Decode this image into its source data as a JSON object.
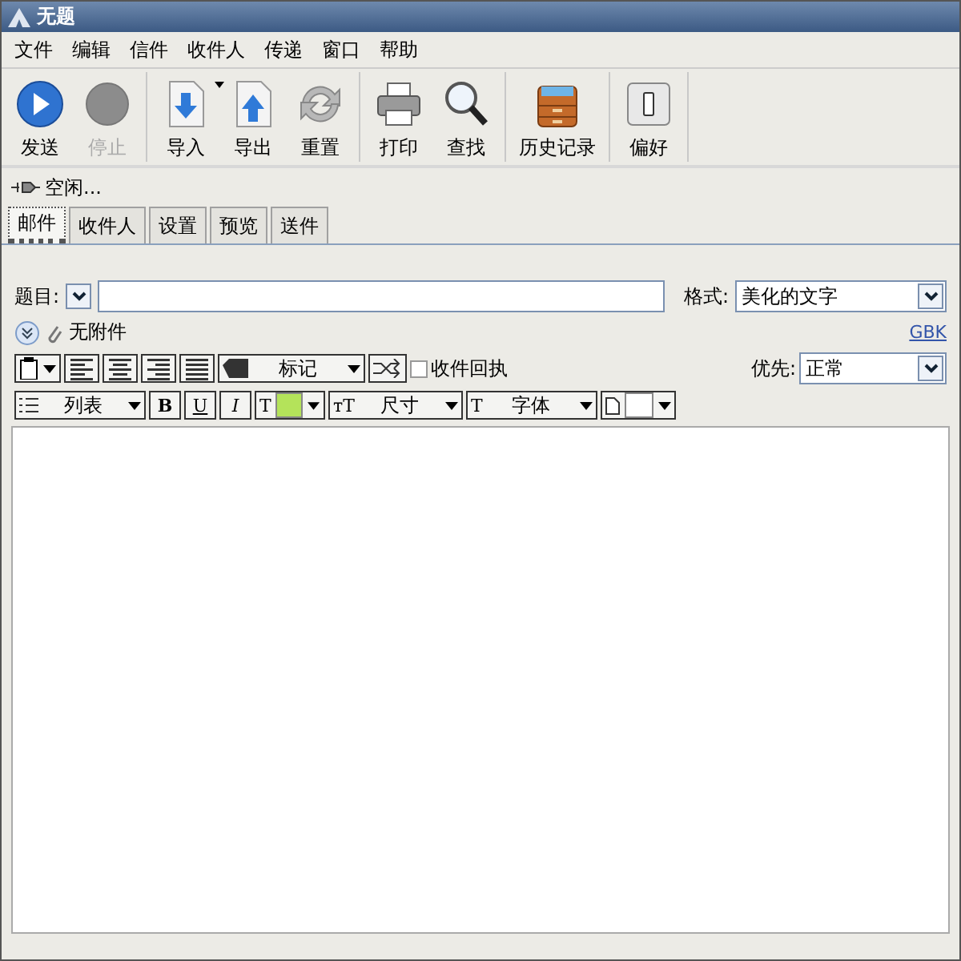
{
  "window": {
    "title": "无题"
  },
  "menu": [
    "文件",
    "编辑",
    "信件",
    "收件人",
    "传递",
    "窗口",
    "帮助"
  ],
  "toolbar": [
    {
      "buttons": [
        {
          "label": "发送",
          "kind": "send",
          "disabled": false
        },
        {
          "label": "停止",
          "kind": "stop",
          "disabled": true
        }
      ]
    },
    {
      "buttons": [
        {
          "label": "导入",
          "kind": "import",
          "disabled": false,
          "dropdown": true
        },
        {
          "label": "导出",
          "kind": "export",
          "disabled": false
        },
        {
          "label": "重置",
          "kind": "reset",
          "disabled": false
        }
      ]
    },
    {
      "buttons": [
        {
          "label": "打印",
          "kind": "print",
          "disabled": false
        },
        {
          "label": "查找",
          "kind": "find",
          "disabled": false
        }
      ]
    },
    {
      "buttons": [
        {
          "label": "历史记录",
          "kind": "history",
          "disabled": false
        }
      ]
    },
    {
      "buttons": [
        {
          "label": "偏好",
          "kind": "prefs",
          "disabled": false
        }
      ]
    }
  ],
  "status": "空闲...",
  "tabs": [
    {
      "label": "邮件",
      "selected": true
    },
    {
      "label": "收件人",
      "selected": false
    },
    {
      "label": "设置",
      "selected": false
    },
    {
      "label": "预览",
      "selected": false
    },
    {
      "label": "送件",
      "selected": false
    }
  ],
  "subject": {
    "label": "题目:"
  },
  "format": {
    "label": "格式:",
    "value": "美化的文字"
  },
  "attachments": {
    "text": "无附件",
    "charset_link": "GBK"
  },
  "format_bar": {
    "mark": "标记",
    "receipt": {
      "label": "收件回执",
      "checked": false
    },
    "priority": {
      "label": "优先:",
      "value": "正常"
    }
  },
  "style_bar": {
    "list": "列表",
    "bold": "B",
    "underline": "U",
    "italic": "I",
    "text_color_glyph": "T",
    "size_glyph": "тT",
    "size": "尺寸",
    "font_glyph": "T",
    "font": "字体"
  }
}
